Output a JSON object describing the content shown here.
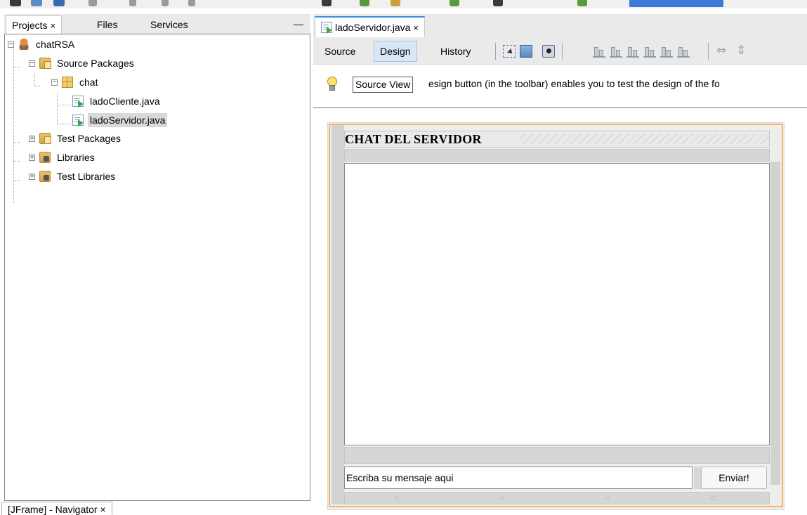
{
  "left_panel": {
    "tabs": [
      {
        "label": "Projects",
        "close": "×"
      },
      {
        "label": "Files"
      },
      {
        "label": "Services"
      }
    ],
    "minimize": "—",
    "tree": [
      {
        "label": "chatRSA"
      },
      {
        "label": "Source Packages"
      },
      {
        "label": "chat"
      },
      {
        "label": "ladoCliente.java"
      },
      {
        "label": "ladoServidor.java"
      },
      {
        "label": "Test Packages"
      },
      {
        "label": "Libraries"
      },
      {
        "label": "Test Libraries"
      }
    ],
    "navigator_tab": "[JFrame] - Navigator ×"
  },
  "editor": {
    "tab": {
      "label": "ladoServidor.java",
      "close": "×"
    },
    "toolbar": {
      "source": "Source",
      "design": "Design",
      "history": "History"
    },
    "tooltip": "Source View",
    "hint_text": "esign button (in the toolbar) enables you to test the design of the fo"
  },
  "form": {
    "title": "CHAT DEL SERVIDOR",
    "input_value": "Escriba su mensaje aqui",
    "send_button": "Enviar!",
    "scroll_glyphs": [
      "<",
      "<",
      "<",
      "<"
    ]
  },
  "colors": {
    "accent_tab": "#3d8ee6",
    "selection_frame": "#f5b466",
    "toolbar_active": "#d8e6f5"
  }
}
